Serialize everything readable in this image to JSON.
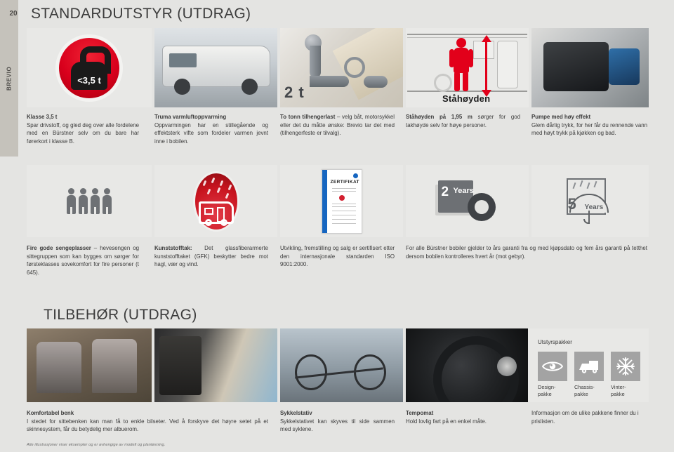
{
  "page": {
    "number": "20",
    "rail_label": "BREVIO",
    "title": "STANDARDUTSTYR (UTDRAG)",
    "title2": "TILBEHØR (UTDRAG)",
    "footnote": "Alle illustrasjoner viser eksempler og er avhengige av modell og planløsning."
  },
  "icons": {
    "weight_label": "<3,5 t",
    "hitch_label": "2 t",
    "standing_label": "Ståhøyden",
    "warranty_years": "2",
    "warranty_years_word": "Years",
    "seal_years": "5",
    "seal_years_word": "Years",
    "certificate_title": "ZERTIFIKAT"
  },
  "standard_row1": [
    {
      "heading": "Klasse 3,5 t",
      "body": "Spar drivstoff, og gled deg over alle fordelene med en Bürstner selv om du bare har førerkort i klasse B."
    },
    {
      "heading": "Truma varmluftoppvarming",
      "body": "Oppvarmingen har en stillegående og effektsterk vifte som fordeler varmen jevnt inne i bobilen."
    },
    {
      "heading": "To tonn tilhengerlast",
      "body": " – velg båt, motorsykkel eller det du måtte ønske: Brevio tar det med (tilhengerfeste er tilvalg)."
    },
    {
      "heading": "Ståhøyden på 1,95 m",
      "body": " sørger for god takhøyde selv for høye personer."
    },
    {
      "heading": "Pumpe med høy effekt",
      "body": "Glem dårlig trykk, for her får du rennende vann med høyt trykk på kjøkken og bad."
    }
  ],
  "standard_row2": [
    {
      "heading": "Fire gode sengeplasser",
      "body": " – hevesengen og sittegruppen som kan bygges om sørger for førsteklasses sovekomfort for fire personer (t 645)."
    },
    {
      "heading": "Kunststofftak:",
      "body": " Det glassfiberarmerte kunststofftaket (GFK) beskytter bedre mot hagl, vær og vind."
    },
    {
      "heading": "",
      "body": "Utvikling, fremstilling og salg er sertifisert etter den internasjonale standarden ISO 9001:2000."
    },
    {
      "heading": "",
      "body": "For alle Bürstner bobiler gjelder to års garanti fra og med kjøpsdato og fem års garanti på tetthet dersom bobilen kontrolleres hvert år (mot gebyr)."
    }
  ],
  "accessories": [
    {
      "heading": "Komfortabel benk",
      "body": "I stedet for sittebenken kan man få to enkle bilseter. Ved å forskyve det høyre setet på et skinnesystem, får du betydelig mer albuerom."
    },
    {
      "heading": "Sykkelstativ",
      "body": "Sykkelstativet kan skyves til side sammen med syklene."
    },
    {
      "heading": "Tempomat",
      "body": "Hold lovlig fart på en enkel måte."
    },
    {
      "heading": "",
      "body": "Informasjon om de ulike pakkene finner du i prislisten."
    }
  ],
  "packages": {
    "title": "Utstyrspakker",
    "items": [
      {
        "label": "Design-\npakke",
        "icon": "eye-icon"
      },
      {
        "label": "Chassis-\npakke",
        "icon": "van-icon"
      },
      {
        "label": "Vinter-\npakke",
        "icon": "snowflake-icon"
      }
    ]
  },
  "colors": {
    "page_bg": "#e4e4e2",
    "tile_bg": "#e8e8e6",
    "rail_bg": "#c5c2bb",
    "accent_red": "#d9001c",
    "text": "#3b3b3b"
  }
}
